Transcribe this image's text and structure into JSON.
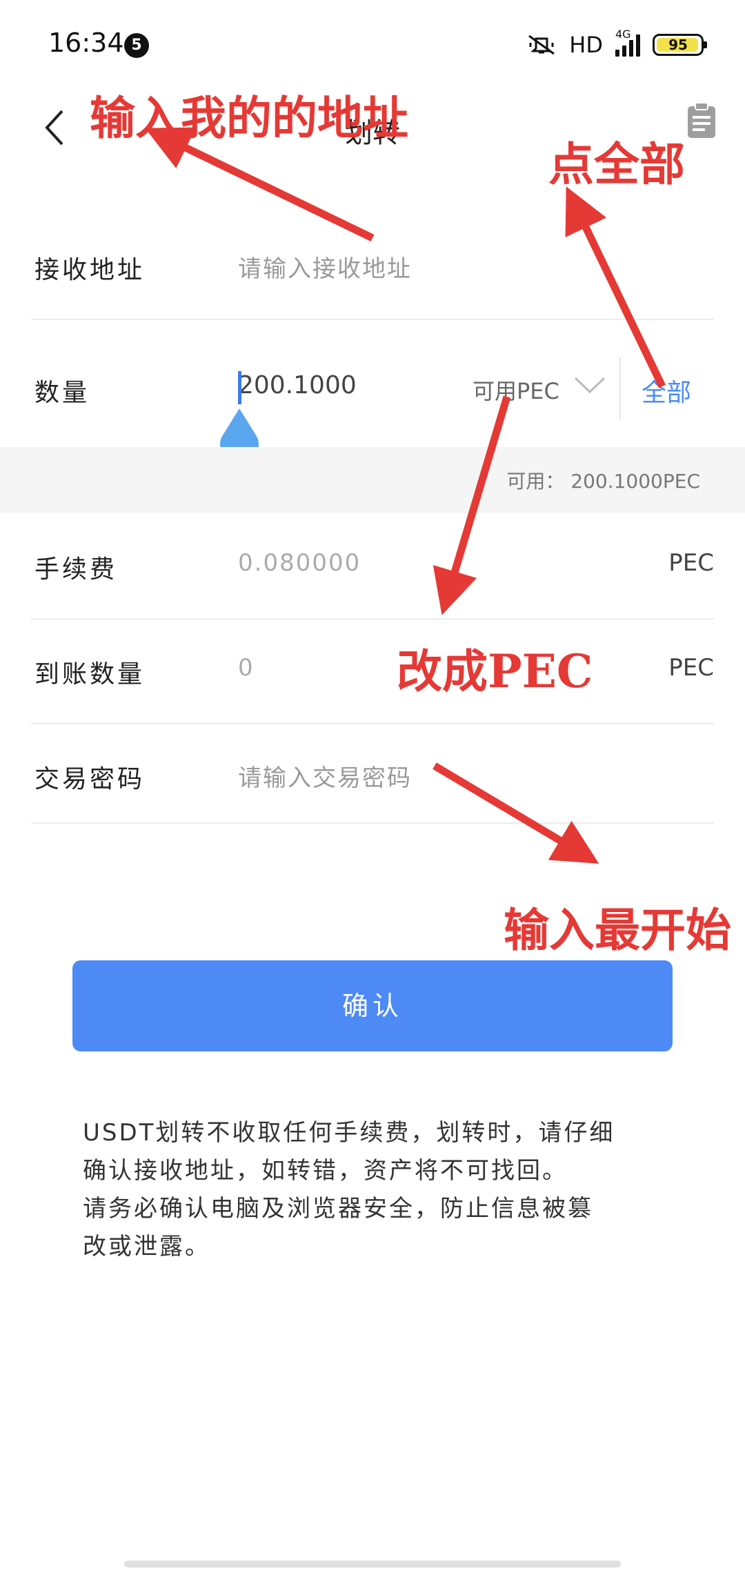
{
  "status_bar": {
    "time": "16:34",
    "notification_count": "5",
    "network": "HD",
    "network_type": "4G",
    "battery": "95",
    "icons": [
      "mute-icon",
      "signal-icon",
      "battery-icon"
    ]
  },
  "header": {
    "title": "划转",
    "back_icon": "chevron-left-icon",
    "clipboard_icon": "clipboard-icon"
  },
  "form": {
    "address": {
      "label": "接收地址",
      "placeholder": "请输入接收地址"
    },
    "amount": {
      "label": "数量",
      "value": "200.1000",
      "coin": "可用PEC",
      "all_label": "全部"
    },
    "available": "可用： 200.1000PEC",
    "fee": {
      "label": "手续费",
      "value": "0.080000",
      "unit": "PEC"
    },
    "receive": {
      "label": "到账数量",
      "value": "0",
      "unit": "PEC"
    },
    "password": {
      "label": "交易密码",
      "placeholder": "请输入交易密码"
    }
  },
  "confirm_button": "确认",
  "notice": [
    "USDT划转不收取任何手续费，划转时，请仔细",
    "确认接收地址，如转错，资产将不可找回。",
    "请务必确认电脑及浏览器安全，防止信息被篡",
    "改或泄露。"
  ],
  "annotations": {
    "input_address": "输入我的的地址",
    "click_all": "点全部",
    "change_pec": "改成PEC",
    "input_start": "输入最开始"
  },
  "colors": {
    "accent": "#4d8af6",
    "annotation": "#e53935"
  }
}
